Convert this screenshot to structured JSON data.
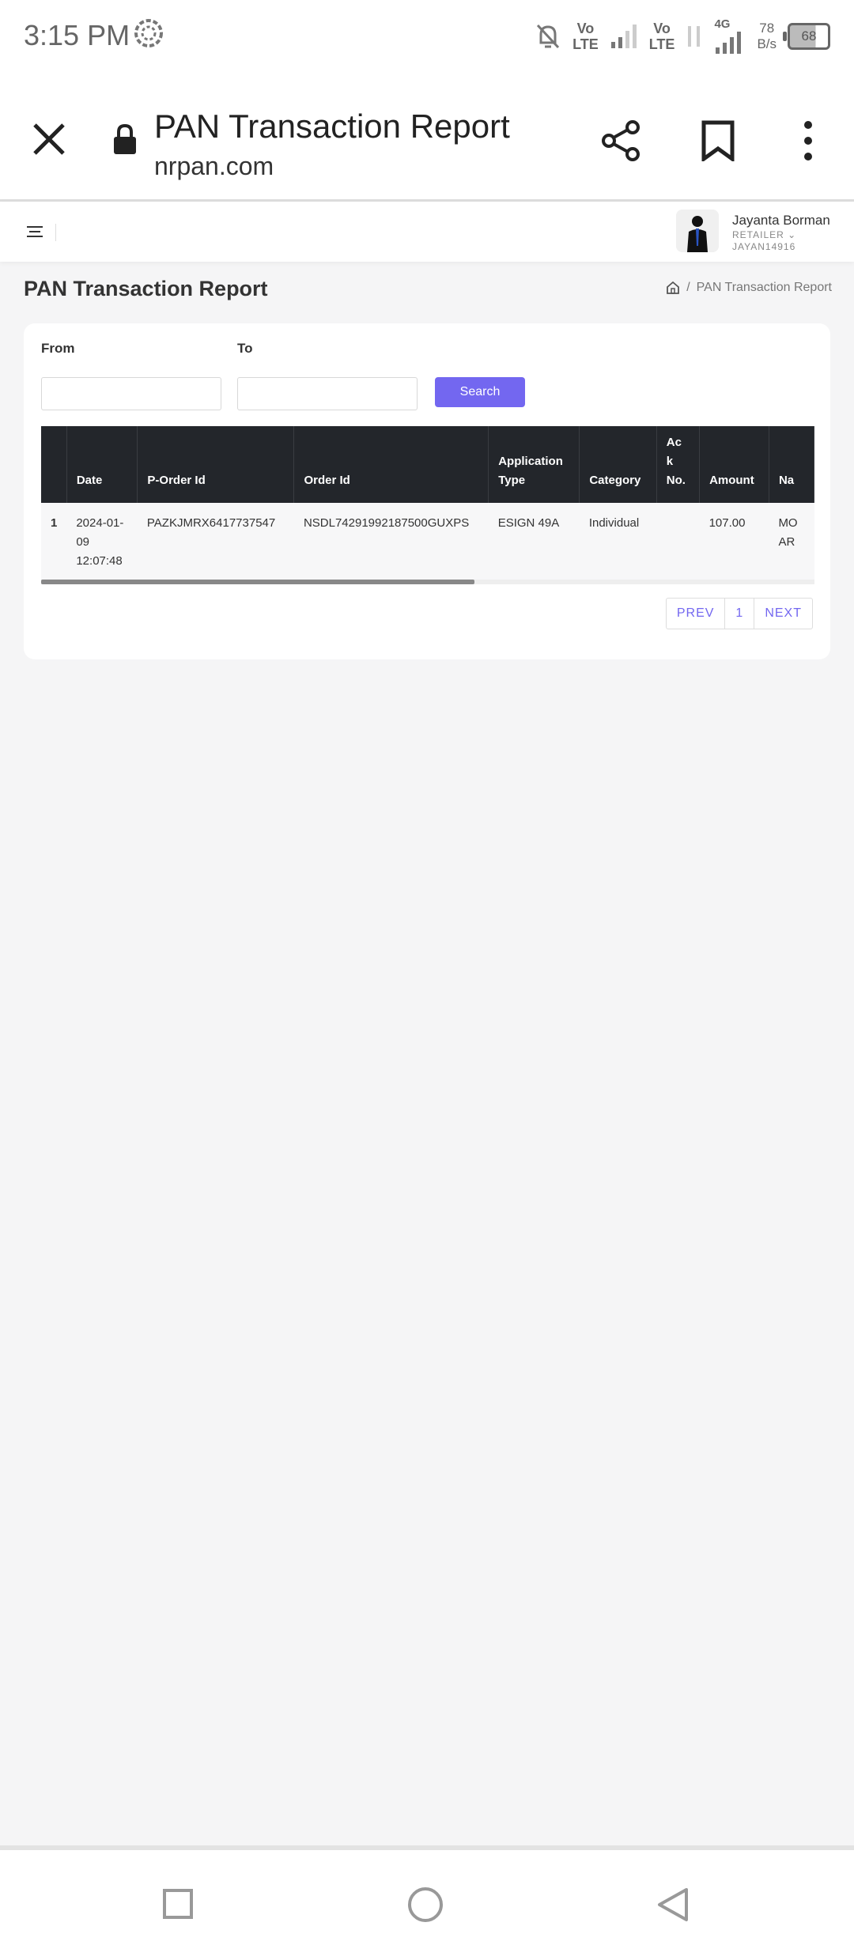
{
  "status_bar": {
    "time": "3:15 PM",
    "sim1": [
      "Vo",
      "LTE"
    ],
    "sim2": [
      "Vo",
      "LTE"
    ],
    "net_type": "4G",
    "speed": [
      "78",
      "B/s"
    ],
    "battery": "68",
    "icons": [
      "sync-icon",
      "bell-off-icon",
      "signal-icon",
      "battery-icon"
    ]
  },
  "browser": {
    "title": "PAN Transaction Report",
    "url": "nrpan.com",
    "icons": [
      "close-icon",
      "lock-icon",
      "share-icon",
      "bookmark-icon",
      "more-vert-icon"
    ]
  },
  "user": {
    "name": "Jayanta Borman",
    "role": "RETAILER ⌄",
    "id": "JAYAN14916"
  },
  "page": {
    "title": "PAN Transaction Report",
    "breadcrumb_sep": "/",
    "breadcrumb_current": "PAN Transaction Report"
  },
  "filter": {
    "from_label": "From",
    "to_label": "To",
    "from_value": "",
    "to_value": "",
    "search_label": "Search"
  },
  "table": {
    "headers": {
      "num": "",
      "date": "Date",
      "porder": "P-Order Id",
      "order": "Order Id",
      "apptype": "Application Type",
      "category": "Category",
      "ack": "Ac k No.",
      "amount": "Amount",
      "name": "Na"
    },
    "rows": [
      {
        "num": "1",
        "date": "2024-01-09 12:07:48",
        "porder": "PAZKJMRX6417737547",
        "order": "NSDL74291992187500GUXPS",
        "apptype": "ESIGN 49A",
        "category": "Individual",
        "ack": "",
        "amount": "107.00",
        "name": "MO AR"
      }
    ]
  },
  "pagination": {
    "prev": "PREV",
    "page": "1",
    "next": "NEXT"
  },
  "colors": {
    "accent": "#7367f0",
    "table_header": "#23262b",
    "background": "#f5f5f6"
  }
}
